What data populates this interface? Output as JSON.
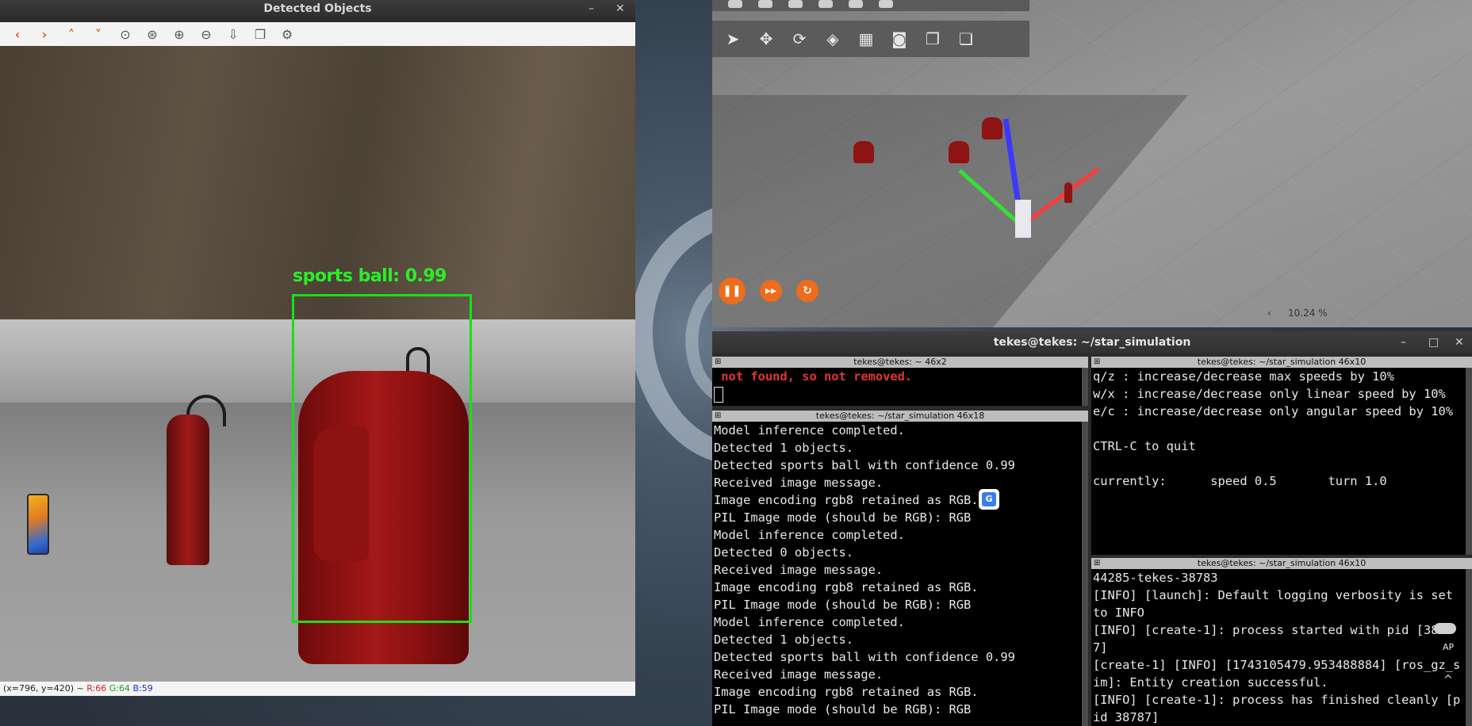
{
  "viewer": {
    "title": "Detected Objects",
    "minimize": "–",
    "close": "✕",
    "detection_label": "sports ball: 0.99",
    "status": {
      "coords": "(x=796, y=420) ~",
      "r": "R:66",
      "g": "G:64",
      "b": "B:59"
    }
  },
  "gazebo": {
    "rtf": "10.24 %",
    "caret": "‹"
  },
  "terminal": {
    "title": "tekes@tekes: ~/star_simulation",
    "minimize": "–",
    "maximize": "□",
    "close": "✕",
    "pane1": {
      "title": "tekes@tekes: ~ 46x2",
      "line1": " not found, so not removed."
    },
    "pane2": {
      "title": "tekes@tekes: ~/star_simulation 46x18",
      "lines": [
        "Model inference completed.",
        "Detected 1 objects.",
        "Detected sports ball with confidence 0.99",
        "Received image message.",
        "Image encoding rgb8 retained as RGB.",
        "PIL Image mode (should be RGB): RGB",
        "Model inference completed.",
        "Detected 0 objects.",
        "Received image message.",
        "Image encoding rgb8 retained as RGB.",
        "PIL Image mode (should be RGB): RGB",
        "Model inference completed.",
        "Detected 1 objects.",
        "Detected sports ball with confidence 0.99",
        "Received image message.",
        "Image encoding rgb8 retained as RGB.",
        "PIL Image mode (should be RGB): RGB"
      ]
    },
    "pane3": {
      "title": "tekes@tekes: ~/star_simulation 46x10",
      "lines": [
        "q/z : increase/decrease max speeds by 10%",
        "w/x : increase/decrease only linear speed by 10%",
        "e/c : increase/decrease only angular speed by 10%",
        "",
        "CTRL-C to quit",
        "",
        "currently:      speed 0.5       turn 1.0"
      ]
    },
    "pane4": {
      "title": "tekes@tekes: ~/star_simulation 46x10",
      "lines": [
        "44285-tekes-38783",
        "[INFO] [launch]: Default logging verbosity is set to INFO",
        "[INFO] [create-1]: process started with pid [38787]",
        "[create-1] [INFO] [1743105479.953488884] [ros_gz_sim]: Entity creation successful.",
        "[INFO] [create-1]: process has finished cleanly [pid 38787]"
      ]
    }
  },
  "tray": {
    "ap": "AP",
    "chevron": "^"
  }
}
